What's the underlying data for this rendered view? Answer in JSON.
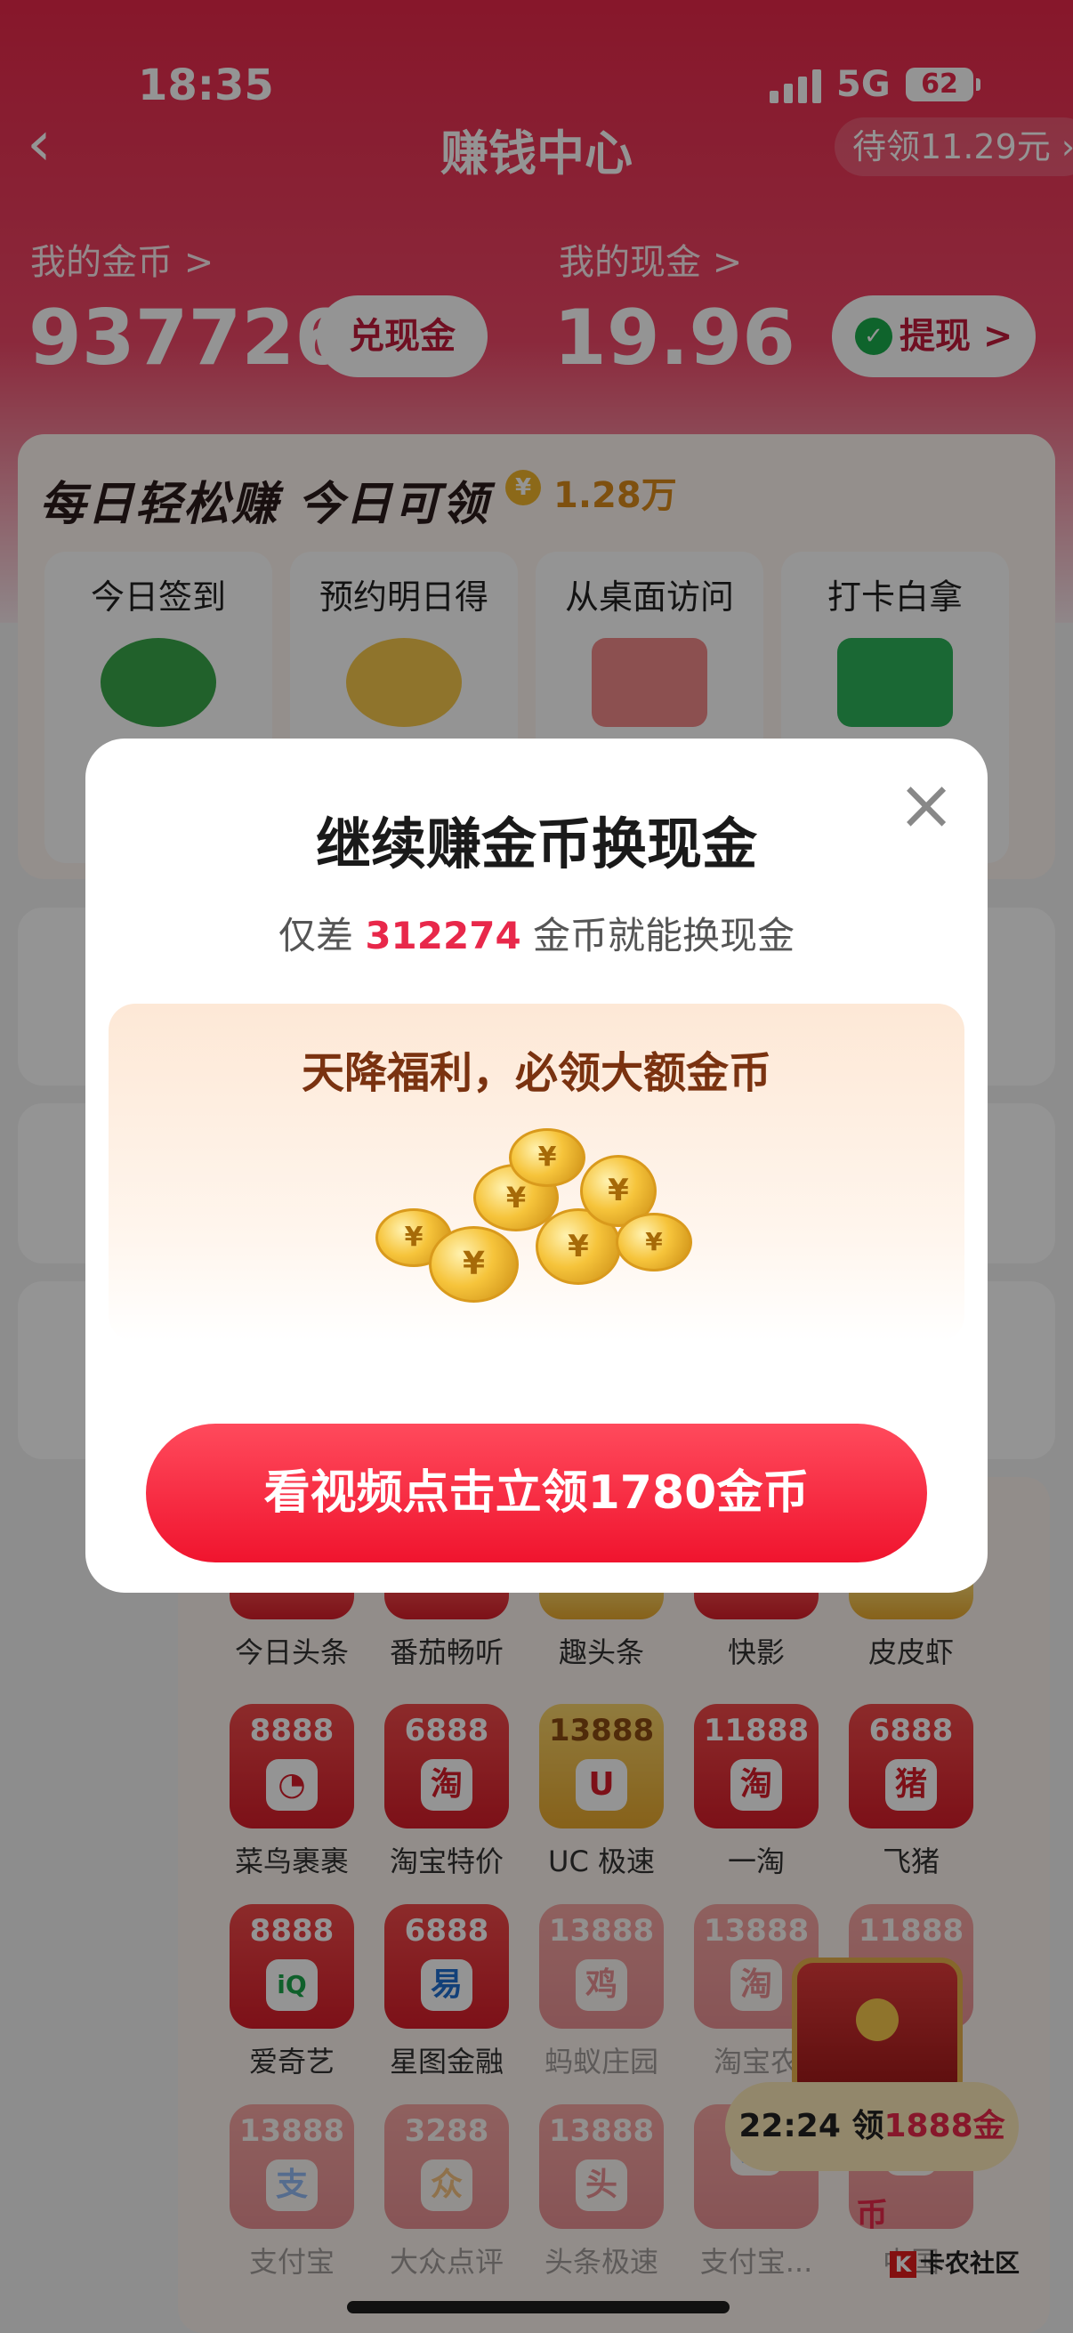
{
  "status_bar": {
    "time": "18:35",
    "network": "5G",
    "battery": "62"
  },
  "nav": {
    "title": "赚钱中心",
    "pending": "待领11.29元"
  },
  "balances": {
    "coins_label": "我的金币 >",
    "coins_value": "937726",
    "exchange_button": "兑现金",
    "cash_label": "我的现金 >",
    "cash_value": "19.96",
    "withdraw_button": "提现 >"
  },
  "daily": {
    "title": "每日轻松赚 今日可领",
    "amount": "1.28万",
    "tasks": [
      {
        "label": "今日签到"
      },
      {
        "label": "预约明日得"
      },
      {
        "label": "从桌面访问"
      },
      {
        "label": "打卡白拿"
      }
    ]
  },
  "apps": [
    {
      "name": "今日头条"
    },
    {
      "name": "番茄畅听"
    },
    {
      "name": "趣头条"
    },
    {
      "name": "快影"
    },
    {
      "name": "皮皮虾"
    },
    {
      "name": "菜鸟裹裹",
      "num": "8888",
      "glyph": "◔"
    },
    {
      "name": "淘宝特价",
      "num": "6888",
      "glyph": "淘"
    },
    {
      "name": "UC 极速",
      "num": "13888",
      "glyph": "U"
    },
    {
      "name": "一淘",
      "num": "11888",
      "glyph": "淘"
    },
    {
      "name": "飞猪",
      "num": "6888",
      "glyph": "猪"
    },
    {
      "name": "爱奇艺",
      "num": "8888",
      "glyph": "iQ"
    },
    {
      "name": "星图金融",
      "num": "6888",
      "glyph": "易"
    },
    {
      "name": "蚂蚁庄园",
      "num": "13888",
      "glyph": "鸡"
    },
    {
      "name": "淘宝农",
      "num": "13888",
      "glyph": "淘"
    },
    {
      "name": "",
      "num": "11888",
      "glyph": ""
    },
    {
      "name": "支付宝",
      "num": "13888",
      "glyph": "支"
    },
    {
      "name": "大众点评",
      "num": "3288",
      "glyph": "众"
    },
    {
      "name": "头条极速",
      "num": "13888",
      "glyph": "头"
    },
    {
      "name": "支付宝...",
      "num": "",
      "glyph": "支"
    },
    {
      "name": "中国",
      "num": "",
      "glyph": "◎"
    }
  ],
  "timer": {
    "time": "22:24",
    "label": "领",
    "reward": "1888金币"
  },
  "watermark": "卡农社区",
  "modal": {
    "title": "继续赚金币换现金",
    "sub_prefix": "仅差",
    "sub_number": "312274",
    "sub_suffix": "金币就能换现金",
    "promo_title": "天降福利，必领大额金币",
    "cta": "看视频点击立领1780金币"
  }
}
